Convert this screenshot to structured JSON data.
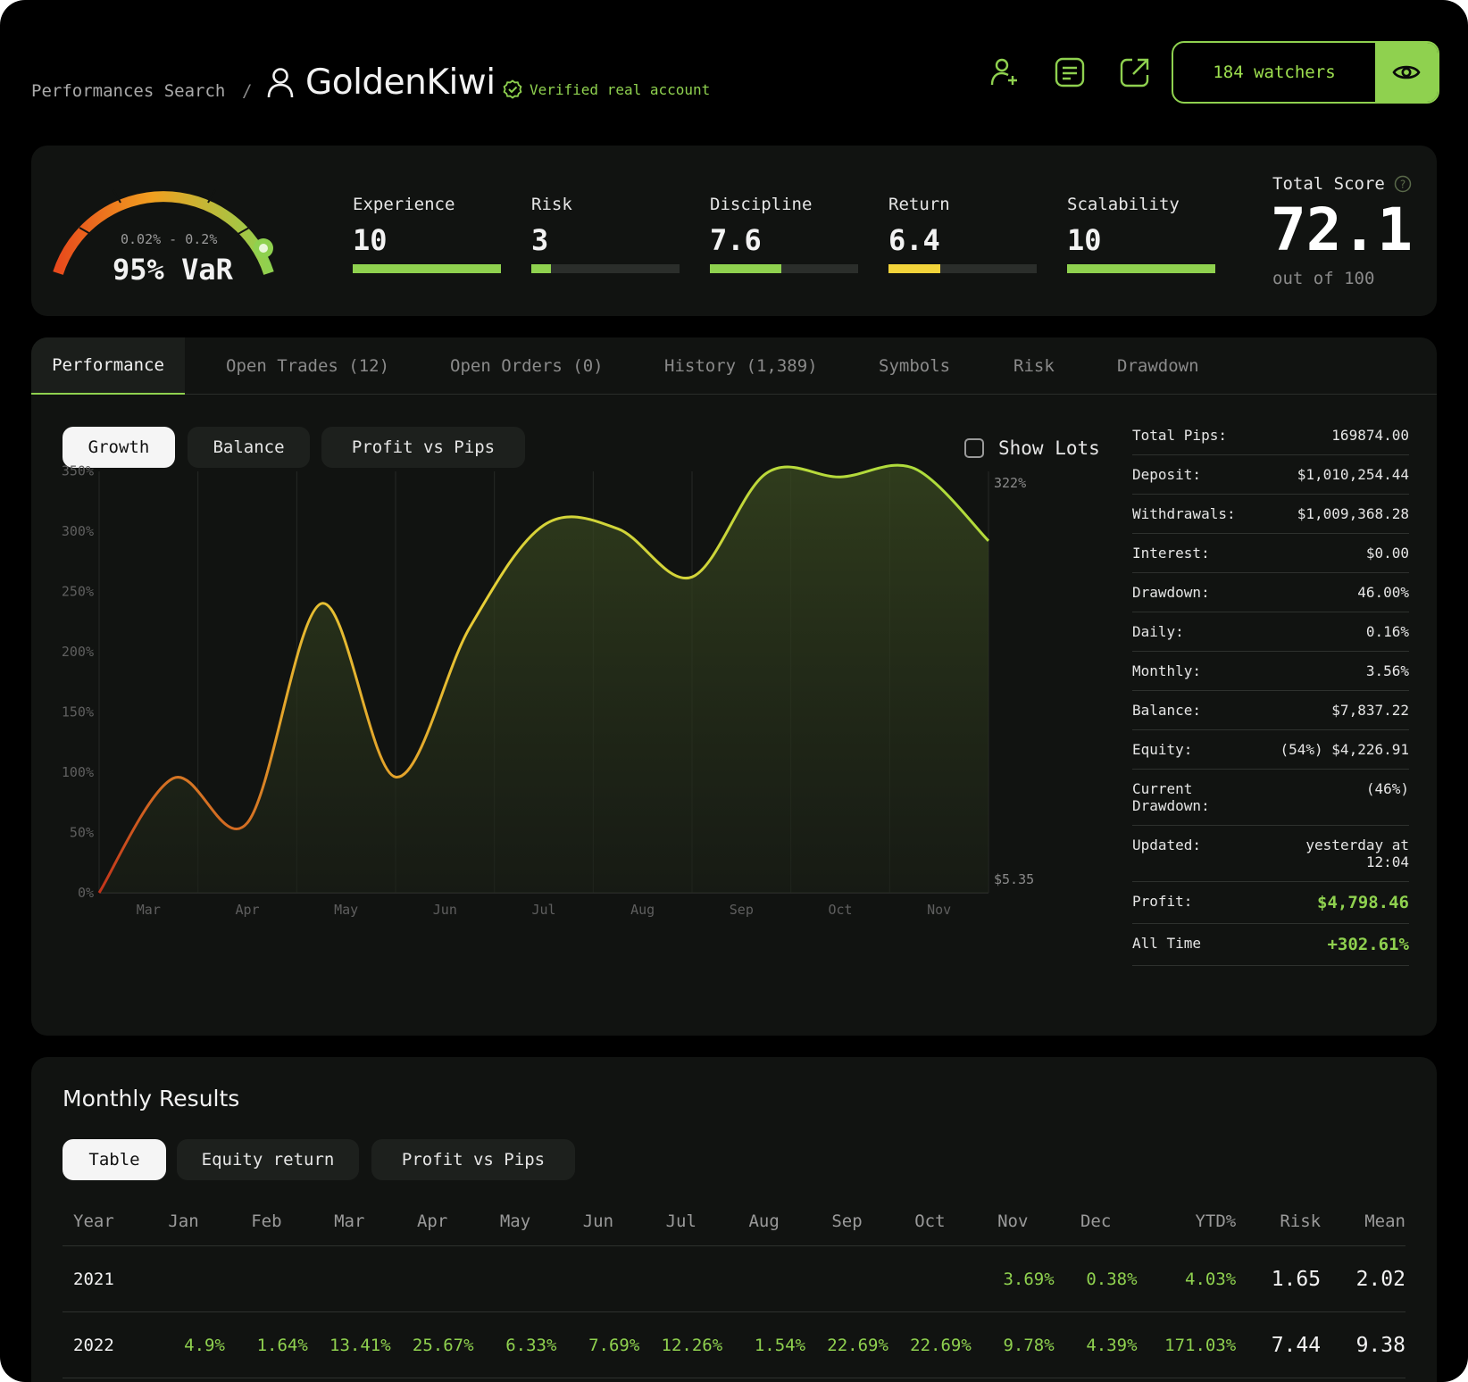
{
  "header": {
    "breadcrumb": "Performances Search",
    "separator": "/",
    "account_name": "GoldenKiwi",
    "verified_label": "Verified real account",
    "watchers_label": "184 watchers"
  },
  "var_gauge": {
    "range": "0.02% - 0.2%",
    "label": "95% VaR"
  },
  "metrics": [
    {
      "name": "Experience",
      "value": "10",
      "level": 1.0,
      "color": "#8fd14f"
    },
    {
      "name": "Risk",
      "value": "3",
      "level": 0.13,
      "color": "#8fd14f"
    },
    {
      "name": "Discipline",
      "value": "7.6",
      "level": 0.48,
      "color": "#8fd14f"
    },
    {
      "name": "Return",
      "value": "6.4",
      "level": 0.35,
      "color": "#f2d33a"
    },
    {
      "name": "Scalability",
      "value": "10",
      "level": 1.0,
      "color": "#8fd14f"
    }
  ],
  "total_score": {
    "title": "Total Score",
    "value": "72.1",
    "subtitle": "out of 100"
  },
  "tabs": [
    "Performance",
    "Open Trades (12)",
    "Open Orders (0)",
    "History (1,389)",
    "Symbols",
    "Risk",
    "Drawdown"
  ],
  "chart_pills": [
    "Growth",
    "Balance",
    "Profit vs Pips"
  ],
  "show_lots_label": "Show Lots",
  "chart_data": {
    "type": "area",
    "x": [
      "Mar",
      "Apr",
      "May",
      "Jun",
      "Jul",
      "Aug",
      "Sep",
      "Oct",
      "Nov"
    ],
    "series": [
      {
        "values": [
          0,
          95,
          58,
          240,
          96,
          220,
          305,
          302,
          262,
          348,
          345,
          352,
          292
        ]
      }
    ],
    "y_ticks": [
      "350%",
      "300%",
      "250%",
      "200%",
      "150%",
      "100%",
      "50%",
      "0%"
    ],
    "ylim": [
      0,
      360
    ],
    "end_label_top": "322%",
    "end_label_bottom": "$5.35",
    "grid": true
  },
  "stats": [
    {
      "k": "Total Pips:",
      "v": "169874.00"
    },
    {
      "k": "Deposit:",
      "v": "$1,010,254.44"
    },
    {
      "k": "Withdrawals:",
      "v": "$1,009,368.28"
    },
    {
      "k": "Interest:",
      "v": "$0.00"
    },
    {
      "k": "Drawdown:",
      "v": "46.00%"
    },
    {
      "k": "Daily:",
      "v": "0.16%"
    },
    {
      "k": "Monthly:",
      "v": "3.56%"
    },
    {
      "k": "Balance:",
      "v": "$7,837.22"
    },
    {
      "k": "Equity:",
      "v": "(54%) $4,226.91"
    },
    {
      "k": "Current\nDrawdown:",
      "v": "(46%)"
    },
    {
      "k": "Updated:",
      "v": "yesterday at\n12:04"
    },
    {
      "k": "Profit:",
      "v": "$4,798.46",
      "green": true
    },
    {
      "k": "All Time",
      "v": "+302.61%",
      "green": true
    }
  ],
  "monthly": {
    "title": "Monthly Results",
    "pills": [
      "Table",
      "Equity return",
      "Profit vs Pips"
    ],
    "columns": [
      "Year",
      "Jan",
      "Feb",
      "Mar",
      "Apr",
      "May",
      "Jun",
      "Jul",
      "Aug",
      "Sep",
      "Oct",
      "Nov",
      "Dec",
      "YTD%",
      "Risk",
      "Mean"
    ],
    "rows": [
      [
        "2021",
        "",
        "",
        "",
        "",
        "",
        "",
        "",
        "",
        "",
        "",
        "3.69%",
        "0.38%",
        "4.03%",
        "1.65",
        "2.02"
      ],
      [
        "2022",
        "4.9%",
        "1.64%",
        "13.41%",
        "25.67%",
        "6.33%",
        "7.69%",
        "12.26%",
        "1.54%",
        "22.69%",
        "22.69%",
        "9.78%",
        "4.39%",
        "171.03%",
        "7.44",
        "9.38"
      ]
    ]
  }
}
